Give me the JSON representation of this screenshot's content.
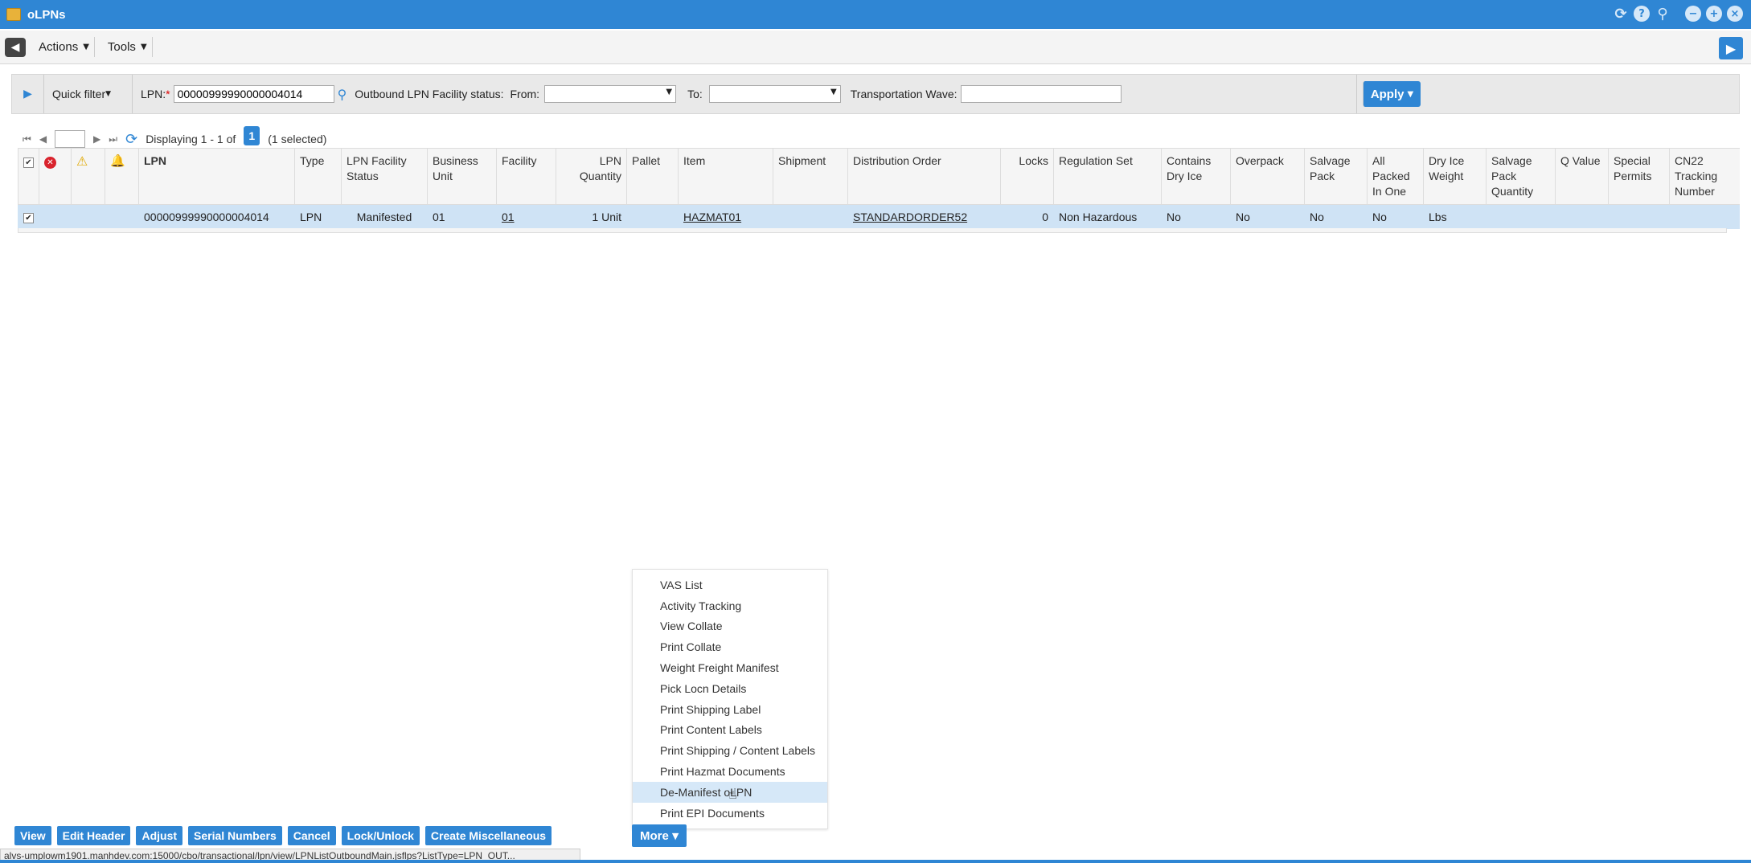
{
  "window": {
    "title": "oLPNs",
    "icons": [
      "refresh-icon",
      "help-icon",
      "pin-icon",
      "minimize-icon",
      "maximize-icon",
      "close-icon"
    ]
  },
  "menubar": {
    "actions_label": "Actions",
    "tools_label": "Tools"
  },
  "filter": {
    "quick_filter_label": "Quick filter",
    "lpn_label": "LPN:",
    "lpn_value": "00000999990000004014",
    "status_label": "Outbound LPN Facility status:",
    "from_label": "From:",
    "to_label": "To:",
    "wave_label": "Transportation Wave:",
    "apply_label": "Apply"
  },
  "pager": {
    "displaying": "Displaying 1 - 1 of",
    "page": "1",
    "selected": "(1 selected)"
  },
  "grid": {
    "columns": {
      "lpn": "LPN",
      "type": "Type",
      "status": "LPN Facility Status",
      "business_unit": "Business Unit",
      "facility": "Facility",
      "quantity": "LPN Quantity",
      "pallet": "Pallet",
      "item": "Item",
      "shipment": "Shipment",
      "order": "Distribution Order",
      "locks": "Locks",
      "regulation": "Regulation Set",
      "dry_ice": "Contains Dry Ice",
      "overpack": "Overpack",
      "salvage": "Salvage Pack",
      "packed_one": "All Packed In One",
      "dry_ice_weight": "Dry Ice Weight",
      "salvage_qty": "Salvage Pack Quantity",
      "q_value": "Q Value",
      "permits": "Special Permits",
      "cn22": "CN22 Tracking Number"
    },
    "row": {
      "lpn": "00000999990000004014",
      "type": "LPN",
      "status": "Manifested",
      "business_unit": "01",
      "facility": "01",
      "quantity": "1 Unit",
      "pallet": "",
      "item": "HAZMAT01",
      "shipment": "",
      "order": "STANDARDORDER52",
      "locks": "0",
      "regulation": "Non Hazardous",
      "dry_ice": "No",
      "overpack": "No",
      "salvage": "No",
      "packed_one": "No",
      "dry_ice_weight": "Lbs",
      "salvage_qty": "",
      "q_value": "",
      "permits": "",
      "cn22": ""
    }
  },
  "more_menu": {
    "items": [
      "VAS List",
      "Activity Tracking",
      "View Collate",
      "Print Collate",
      "Weight Freight Manifest",
      "Pick Locn Details",
      "Print Shipping Label",
      "Print Content Labels",
      "Print Shipping / Content Labels",
      "Print Hazmat Documents",
      "De-Manifest oLPN",
      "Print EPI Documents"
    ],
    "highlighted_index": 10
  },
  "actions": {
    "view": "View",
    "edit_header": "Edit Header",
    "adjust": "Adjust",
    "serial_numbers": "Serial Numbers",
    "cancel": "Cancel",
    "lock_unlock": "Lock/Unlock",
    "create_misc": "Create Miscellaneous",
    "more": "More"
  },
  "statusbar": {
    "url": "alvs-umplowm1901.manhdev.com:15000/cbo/transactional/lpn/view/LPNListOutboundMain.jsflps?ListType=LPN_OUT..."
  },
  "colors": {
    "accent": "#2f86d4",
    "selected_row": "#cfe3f5",
    "error": "#d9232d",
    "warning": "#e0a800"
  }
}
